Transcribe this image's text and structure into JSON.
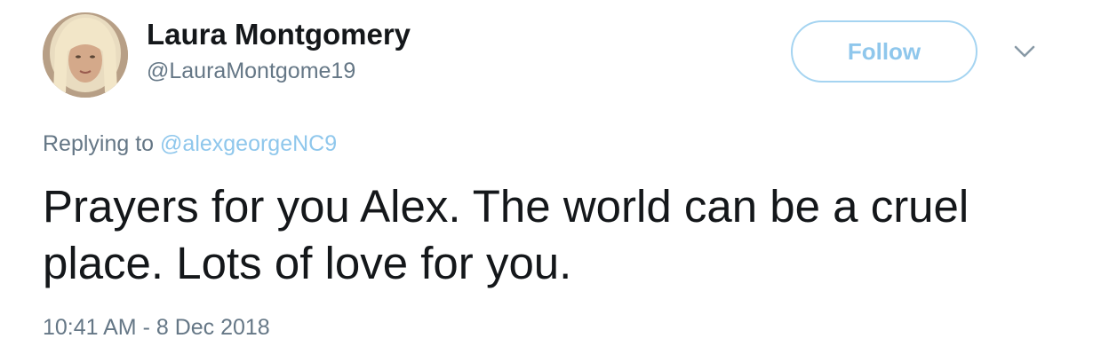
{
  "user": {
    "display_name": "Laura Montgomery",
    "handle": "@LauraMontgome19"
  },
  "actions": {
    "follow_label": "Follow",
    "more_icon": "chevron-down-icon"
  },
  "reply": {
    "prefix": "Replying to",
    "to_handle": "@alexgeorgeNC9"
  },
  "tweet": {
    "text": "Prayers for you Alex. The world can be a cruel place. Lots of love for you.",
    "timestamp": "10:41 AM - 8 Dec 2018"
  },
  "colors": {
    "name_text": "#14171a",
    "secondary_text": "#657786",
    "link_accent": "#8fc7ec",
    "follow_border": "#a5d4f1"
  }
}
